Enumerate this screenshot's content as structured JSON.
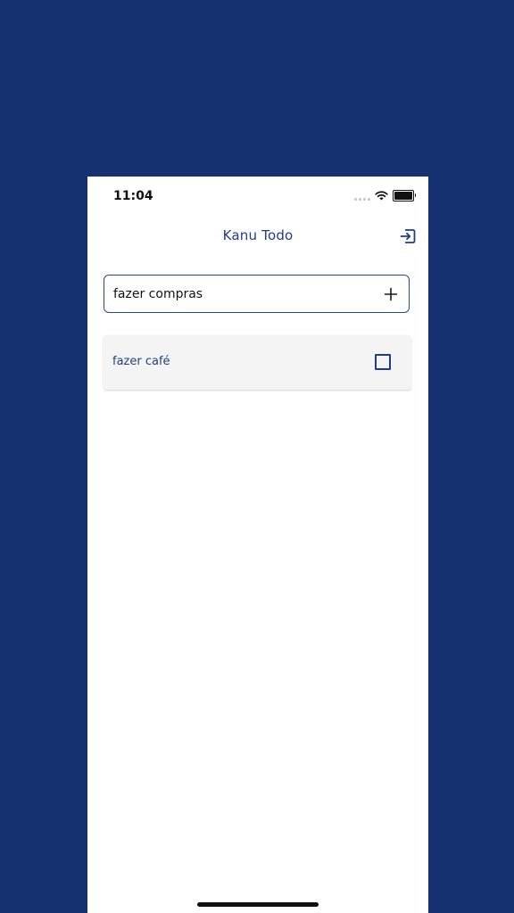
{
  "status_bar": {
    "time": "11:04",
    "icons": [
      "signal-icon",
      "wifi-icon",
      "battery-icon"
    ]
  },
  "header": {
    "title": "Kanu Todo",
    "logout_icon": "logout-icon"
  },
  "new_todo": {
    "value": "fazer compras",
    "add_icon": "plus-icon"
  },
  "todos": [
    {
      "text": "fazer café",
      "checked": false
    }
  ],
  "colors": {
    "background": "#163170",
    "accent": "#1d3f86",
    "card": "#f4f4f4"
  }
}
